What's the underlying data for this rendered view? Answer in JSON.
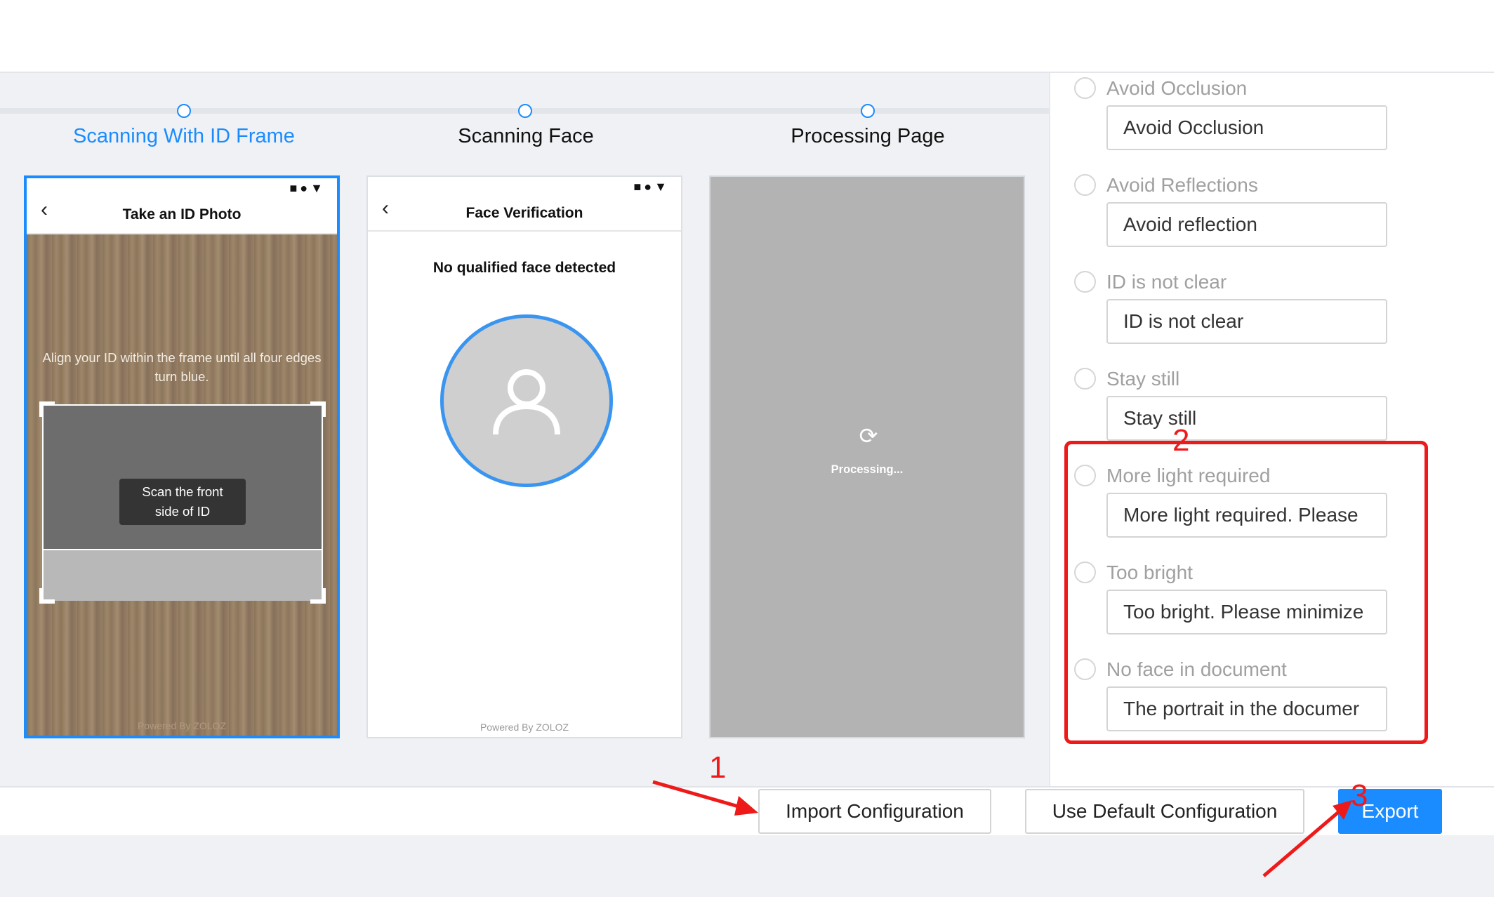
{
  "steps": [
    {
      "label": "Scanning With ID Frame",
      "active": true
    },
    {
      "label": "Scanning Face",
      "active": false
    },
    {
      "label": "Processing Page",
      "active": false
    }
  ],
  "phones": {
    "id": {
      "status_icons": "■●▼",
      "title": "Take an ID Photo",
      "instruction": "Align your ID within the frame until all four edges turn blue.",
      "scan_tip_line1": "Scan the front",
      "scan_tip_line2": "side of ID",
      "powered": "Powered By ZOLOZ"
    },
    "face": {
      "status_icons": "■●▼",
      "title": "Face Verification",
      "message": "No qualified face detected",
      "powered": "Powered By ZOLOZ"
    },
    "processing": {
      "text": "Processing..."
    }
  },
  "options": [
    {
      "label": "Avoid Occlusion",
      "value": "Avoid Occlusion"
    },
    {
      "label": "Avoid Reflections",
      "value": "Avoid reflection"
    },
    {
      "label": "ID is not clear",
      "value": "ID is not clear"
    },
    {
      "label": "Stay still",
      "value": "Stay still"
    },
    {
      "label": "More light required",
      "value": "More light required. Please"
    },
    {
      "label": "Too bright",
      "value": "Too bright. Please minimize"
    },
    {
      "label": "No face in document",
      "value": "The portrait in the documer"
    }
  ],
  "buttons": {
    "import": "Import Configuration",
    "default": "Use Default Configuration",
    "export": "Export"
  },
  "annotations": {
    "n1": "1",
    "n2": "2",
    "n3": "3",
    "color": "#ee1a1a"
  },
  "colors": {
    "accent": "#1a8cff",
    "annotation": "#ee1a1a"
  }
}
